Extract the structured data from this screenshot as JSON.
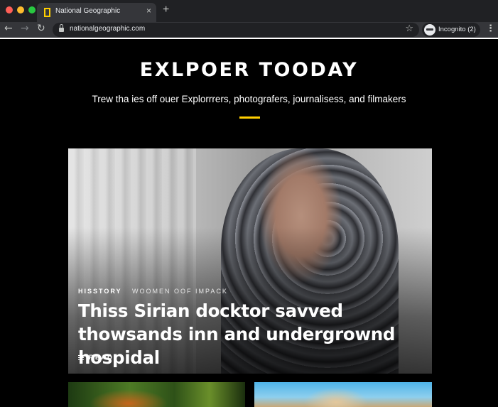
{
  "browser": {
    "tab": {
      "title": "National Geographic",
      "close_glyph": "×"
    },
    "new_tab_glyph": "+",
    "nav": {
      "back_glyph": "←",
      "forward_glyph": "→",
      "reload_glyph": "↻"
    },
    "url": "nationalgeographic.com",
    "bookmark_glyph": "☆",
    "profile_label": "Incognito (2)",
    "menu_glyph": "⋮"
  },
  "hero": {
    "title": "EXLPOER TOODAY",
    "subtitle": "Trew tha ies off ouer Explorrrers, photografers, journalisess, and filmakers",
    "accent_color": "#ffce00"
  },
  "feature": {
    "category": "HISSTORY",
    "series": "WOOMEN OOF IMPACK",
    "headline": "Thiss Sirian docktor savved thowsands inn and undergrownd hospidal",
    "read_label": "READ"
  },
  "icons": {
    "tab_favicon": "natgeo-frame-icon",
    "lock": "lock-icon",
    "read": "lines-icon"
  }
}
